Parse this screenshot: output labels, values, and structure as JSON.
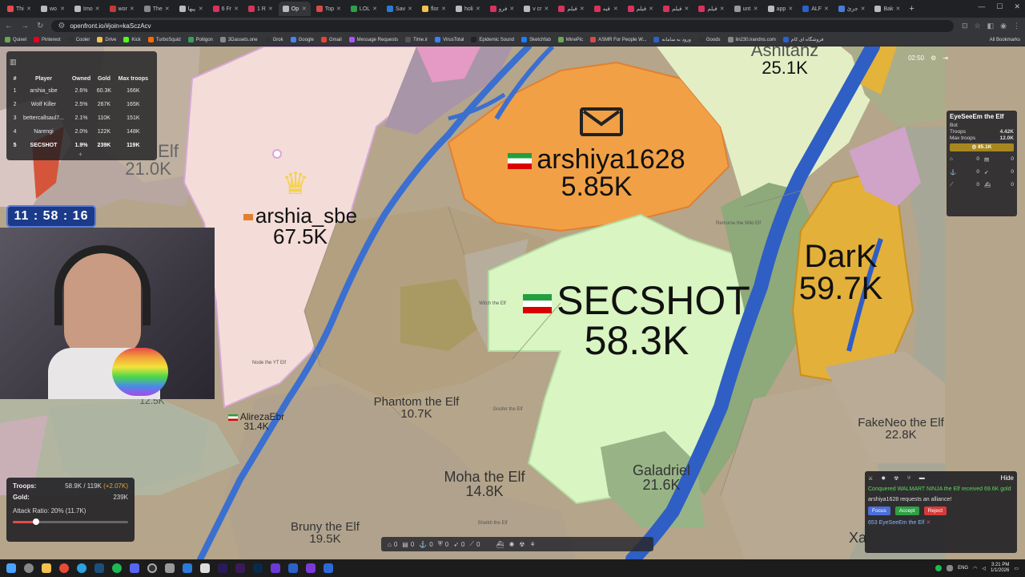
{
  "browser": {
    "tabs": [
      "Thi",
      "wo",
      "Imo",
      "wor",
      "The",
      "پیها",
      "6 Fr",
      "1 R",
      "Op",
      "Top",
      "LOL",
      "Sav",
      "flor",
      "holi",
      "فرو",
      "v cr",
      "فیلم",
      "قیه",
      "فیلم",
      "فیلم",
      "فیلم",
      "unt",
      "app",
      "ALF",
      "جزئ",
      "Bak"
    ],
    "active_tab_index": 8,
    "url": "openfront.io/#join=kaSczAcv",
    "bookmarks": [
      "Quixel",
      "Pinterest",
      "Cooler",
      "Drive",
      "Kick",
      "TurboSquid",
      "Poliigon",
      "3Dassets.one",
      "Grok",
      "Google",
      "Gmail",
      "Message Requests",
      "Time.ir",
      "VirusTotal",
      "Epidemic Sound",
      "Sketchfab",
      "MinePic",
      "ASMR For People W...",
      "ورود به سامانه",
      "Goods",
      "lin230.irandns.com",
      "فروشگاه ای کام"
    ],
    "all_bookmarks": "All Bookmarks"
  },
  "leaderboard": {
    "headers": [
      "#",
      "Player",
      "Owned",
      "Gold",
      "Max troops"
    ],
    "rows": [
      {
        "rank": "1",
        "player": "arshia_sbe",
        "owned": "2.6%",
        "gold": "60.3K",
        "max": "166K"
      },
      {
        "rank": "2",
        "player": "Wolf Killer",
        "owned": "2.5%",
        "gold": "267K",
        "max": "165K"
      },
      {
        "rank": "3",
        "player": "bettercallsaul7...",
        "owned": "2.1%",
        "gold": "110K",
        "max": "151K"
      },
      {
        "rank": "4",
        "player": "Narengi",
        "owned": "2.0%",
        "gold": "122K",
        "max": "148K"
      },
      {
        "rank": "5",
        "player": "SECSHOT",
        "owned": "1.9%",
        "gold": "239K",
        "max": "119K"
      }
    ]
  },
  "timer": "11 : 58 : 16",
  "map_labels": {
    "elf": {
      "name": "Elf",
      "value": "21.0K"
    },
    "arshia": {
      "name": "arshia_sbe",
      "value": "67.5K"
    },
    "arshiya": {
      "name": "arshiya1628",
      "value": "5.85K"
    },
    "secshot": {
      "name": "SECSHOT",
      "value": "58.3K"
    },
    "dark": {
      "name": "DarK",
      "value": "59.7K"
    },
    "phantom": {
      "name": "Phantom the Elf",
      "value": "10.7K"
    },
    "moha": {
      "name": "Moha the Elf",
      "value": "14.8K"
    },
    "galadriel": {
      "name": "Galadriel",
      "value": "21.6K"
    },
    "fakeneo": {
      "name": "FakeNeo the Elf",
      "value": "22.8K"
    },
    "bruny": {
      "name": "Bruny the Elf",
      "value": "19.5K"
    },
    "aliureza": {
      "name": "AlirezaEbr",
      "value": "31.4K"
    },
    "top": {
      "name": "Ashitanz",
      "value": "25.1K"
    },
    "small1": "Node the YT Elf",
    "small2": "Goofer the Elf",
    "small3": "Remorse the Wiki Elf",
    "small4": "Sheikh the Elf",
    "small5": "Witch the Elf",
    "small_left": "12.5K",
    "xa": "Xa"
  },
  "player_stats": {
    "troops_label": "Troops:",
    "troops_value": "58.9K / 119K",
    "troops_delta": "(+2.07K)",
    "gold_label": "Gold:",
    "gold_value": "239K",
    "attack_ratio": "Attack Ratio: 20% (11.7K)",
    "attack_ratio_fraction": 0.2
  },
  "toolbar": {
    "counts": [
      "0",
      "0",
      "0",
      "0",
      "0",
      "0"
    ]
  },
  "hud_clock": "02:50",
  "side_panel": {
    "name": "EyeSeeEm the Elf",
    "type": "Bot",
    "troops_label": "Troops",
    "troops_value": "4.42K",
    "max_label": "Max troops",
    "max_value": "12.0K",
    "gold_value": "85.1K",
    "grid": [
      "0",
      "0",
      "0",
      "0",
      "0",
      "0"
    ]
  },
  "events": {
    "hide": "Hide",
    "conquered": "Conquered WALMART NINJA the Elf received 69.6K gold",
    "alliance": "arshiya1628 requests an alliance!",
    "focus": "Focus",
    "accept": "Accept",
    "reject": "Reject",
    "footer": "653 EyeSeeEm the Elf"
  },
  "taskbar": {
    "lang": "ENG",
    "time": "3:21 PM",
    "date": "1/1/2026"
  },
  "colors": {
    "secshot": "#d9f5c2",
    "arshiya": "#f2a045",
    "dark": "#e6b13a",
    "arshia": "#f6dada",
    "river": "#3b6fd0"
  }
}
